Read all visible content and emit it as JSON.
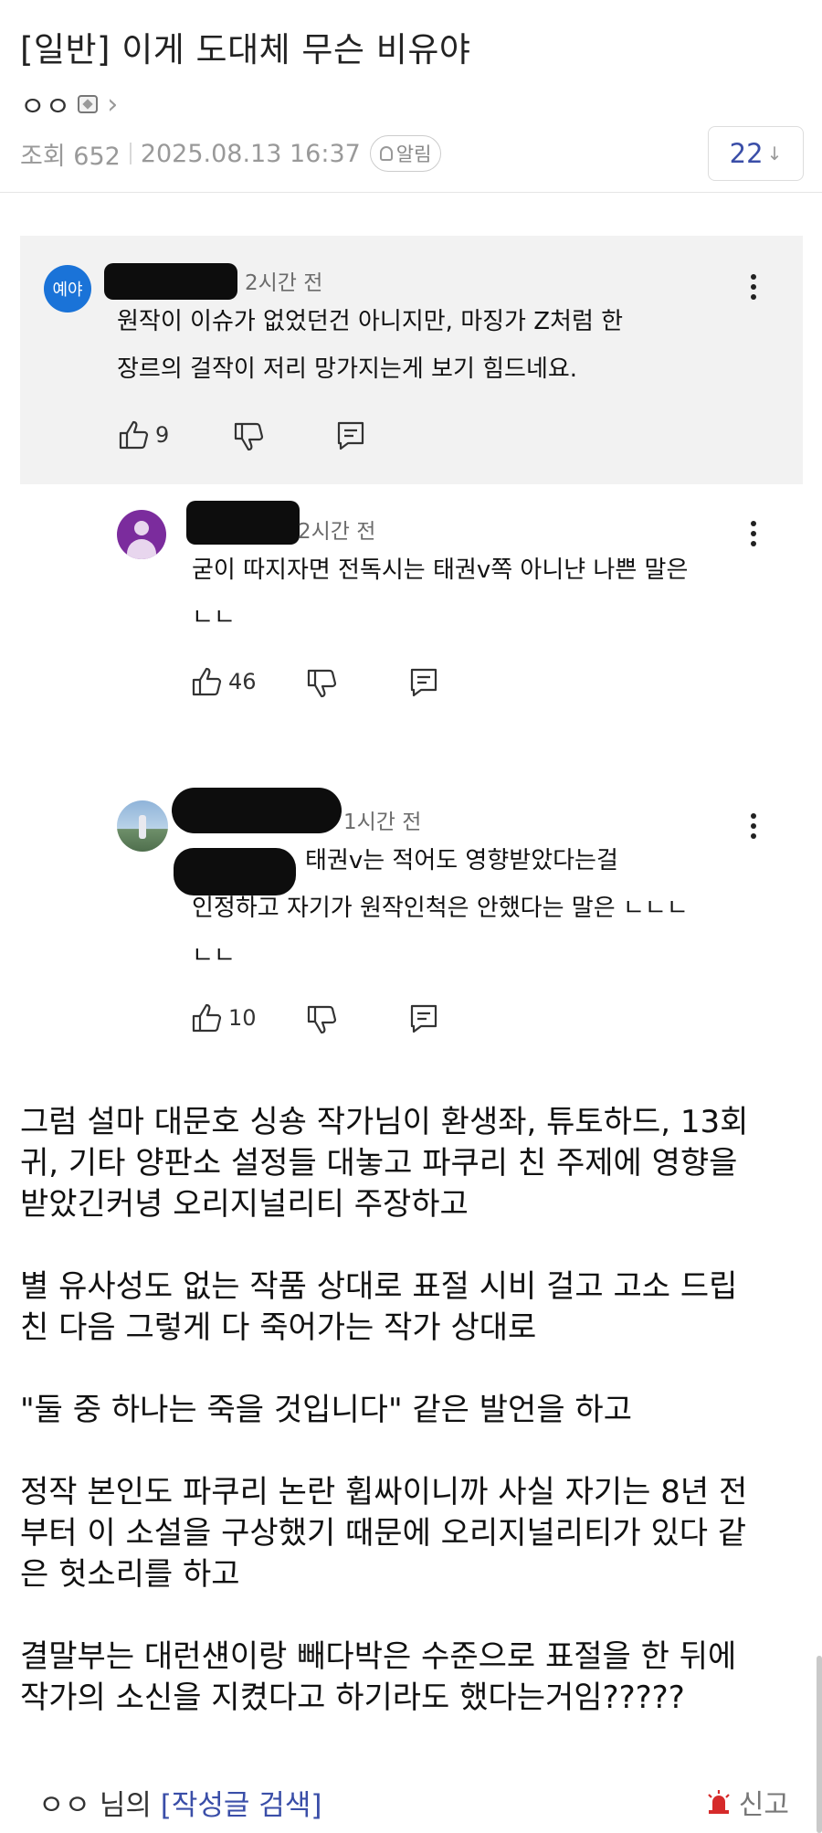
{
  "post": {
    "title": "[일반] 이게 도대체 무슨 비유야",
    "author": "ㅇㅇ",
    "views": "조회 652",
    "datetime": "2025.08.13 16:37",
    "notify_label": "알림",
    "comment_count": "22",
    "comment_count_arrow": "↓"
  },
  "embedded_comments": [
    {
      "avatar_text": "예야",
      "avatar_color": "#1a73d8",
      "time": "2시간 전",
      "lines": [
        "원작이 이슈가 없었던건 아니지만, 마징가 Z처럼 한",
        "장르의 걸작이 저리 망가지는게 보기 힘드네요."
      ],
      "likes": "9"
    },
    {
      "avatar_color": "#7b2c9d",
      "time": "2시간 전",
      "lines": [
        "굳이 따지자면 전독시는 태권v쪽 아니냔 나쁜 말은",
        "ㄴㄴ"
      ],
      "likes": "46"
    },
    {
      "time": "1시간 전",
      "lines": [
        "태권v는 적어도 영향받았다는걸",
        "인정하고 자기가 원작인척은 안했다는 말은 ㄴㄴㄴ",
        "ㄴㄴ"
      ],
      "likes": "10"
    }
  ],
  "body": [
    "그럼 설마 대문호 싱숑 작가님이 환생좌, 튜토하드, 13회\n귀, 기타 양판소 설정들 대놓고 파쿠리 친 주제에 영향을\n받았긴커녕 오리지널리티 주장하고",
    "별 유사성도 없는 작품 상대로 표절 시비 걸고 고소 드립\n친 다음 그렇게 다 죽어가는 작가 상대로",
    "\"둘 중 하나는 죽을 것입니다\" 같은 발언을 하고",
    "정작 본인도 파쿠리 논란 휩싸이니까 사실 자기는 8년 전\n부터 이 소설을 구상했기 때문에 오리지널리티가 있다 같\n은 헛소리를 하고",
    "결말부는 대런섄이랑 빼다박은 수준으로 표절을 한 뒤에\n작가의 소신을 지켰다고 하기라도 했다는거임?????"
  ],
  "footer": {
    "author": "ㅇㅇ",
    "suffix": " 님의 ",
    "search_link": "[작성글 검색]",
    "report_label": "신고"
  },
  "colors": {
    "link": "#3a4ea8",
    "report_icon": "#d62b2b",
    "embed_bg": "#f2f2f2"
  }
}
